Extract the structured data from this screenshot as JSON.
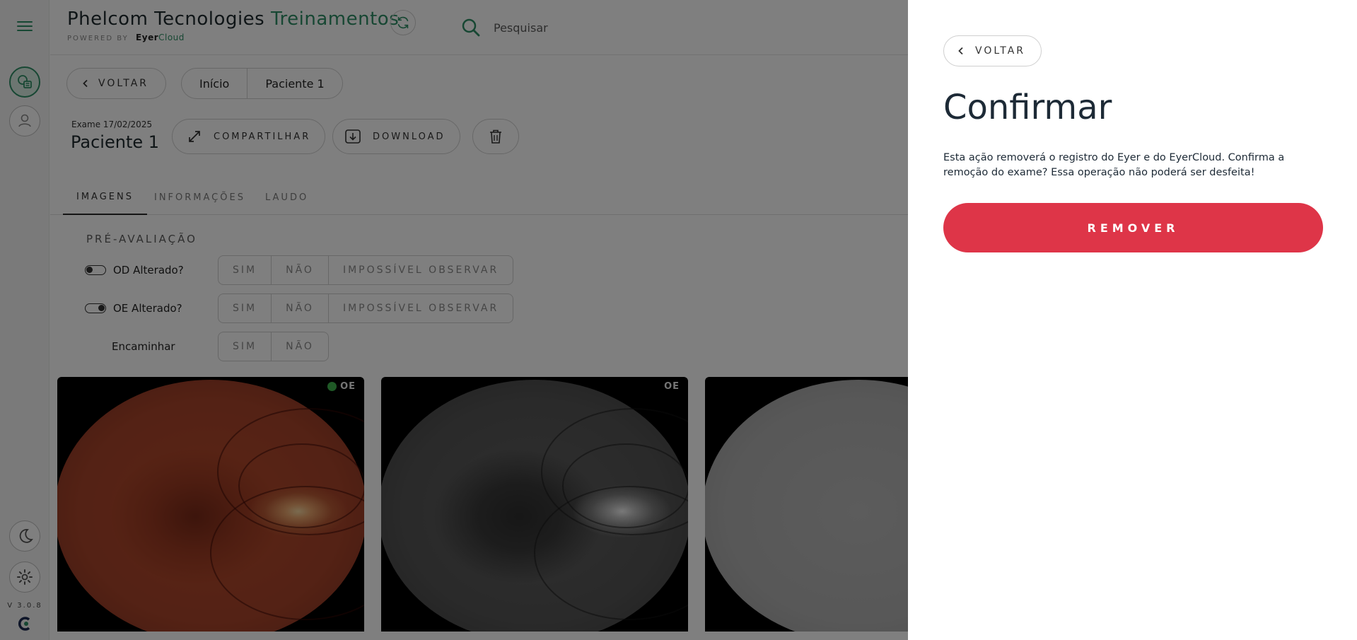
{
  "app": {
    "brand_title_main": "Phelcom Tecnologies",
    "brand_title_accent": "Treinamentos",
    "brand_powered_by": "POWERED BY",
    "brand_eyer": "Eyer",
    "brand_cloud": "Cloud",
    "version": "V 3.0.8"
  },
  "header": {
    "search_placeholder": "Pesquisar"
  },
  "nav": {
    "back_label": "VOLTAR",
    "breadcrumbs": [
      "Início",
      "Paciente 1"
    ]
  },
  "exam": {
    "date_label": "Exame 17/02/2025",
    "patient_name": "Paciente 1",
    "share_label": "COMPARTILHAR",
    "download_label": "DOWNLOAD"
  },
  "tabs": [
    {
      "label": "IMAGENS",
      "active": true
    },
    {
      "label": "INFORMAÇÕES",
      "active": false
    },
    {
      "label": "LAUDO",
      "active": false
    }
  ],
  "pre_evaluation": {
    "title": "PRÉ-AVALIAÇÃO",
    "questions": [
      {
        "label": "OD Alterado?",
        "options": [
          "SIM",
          "NÃO",
          "IMPOSSÍVEL OBSERVAR"
        ]
      },
      {
        "label": "OE Alterado?",
        "options": [
          "SIM",
          "NÃO",
          "IMPOSSÍVEL OBSERVAR"
        ]
      },
      {
        "label": "Encaminhar",
        "options": [
          "SIM",
          "NÃO"
        ]
      }
    ]
  },
  "images": [
    {
      "eye": "OE",
      "indicator": true
    },
    {
      "eye": "OE",
      "indicator": false
    },
    {
      "eye": "",
      "indicator": false
    }
  ],
  "colors": {
    "brand_green": "#2f8f66",
    "danger": "#de3548",
    "indicator_green": "#3fb24d"
  },
  "dialog": {
    "back_label": "VOLTAR",
    "title": "Confirmar",
    "message": "Esta ação removerá o registro do Eyer e do EyerCloud. Confirma a remoção do exame? Essa operação não poderá ser desfeita!",
    "confirm_label": "REMOVER"
  },
  "icons": {
    "menu": "hamburger-icon",
    "exams": "exam-list-icon",
    "patients": "user-icon",
    "dark_mode": "moon-icon",
    "settings": "gear-icon",
    "logo": "eyercloud-logo-icon",
    "sync": "refresh-icon",
    "search": "search-icon",
    "back": "chevron-left-icon",
    "share": "expand-arrows-icon",
    "download": "download-icon",
    "delete": "trash-icon"
  }
}
